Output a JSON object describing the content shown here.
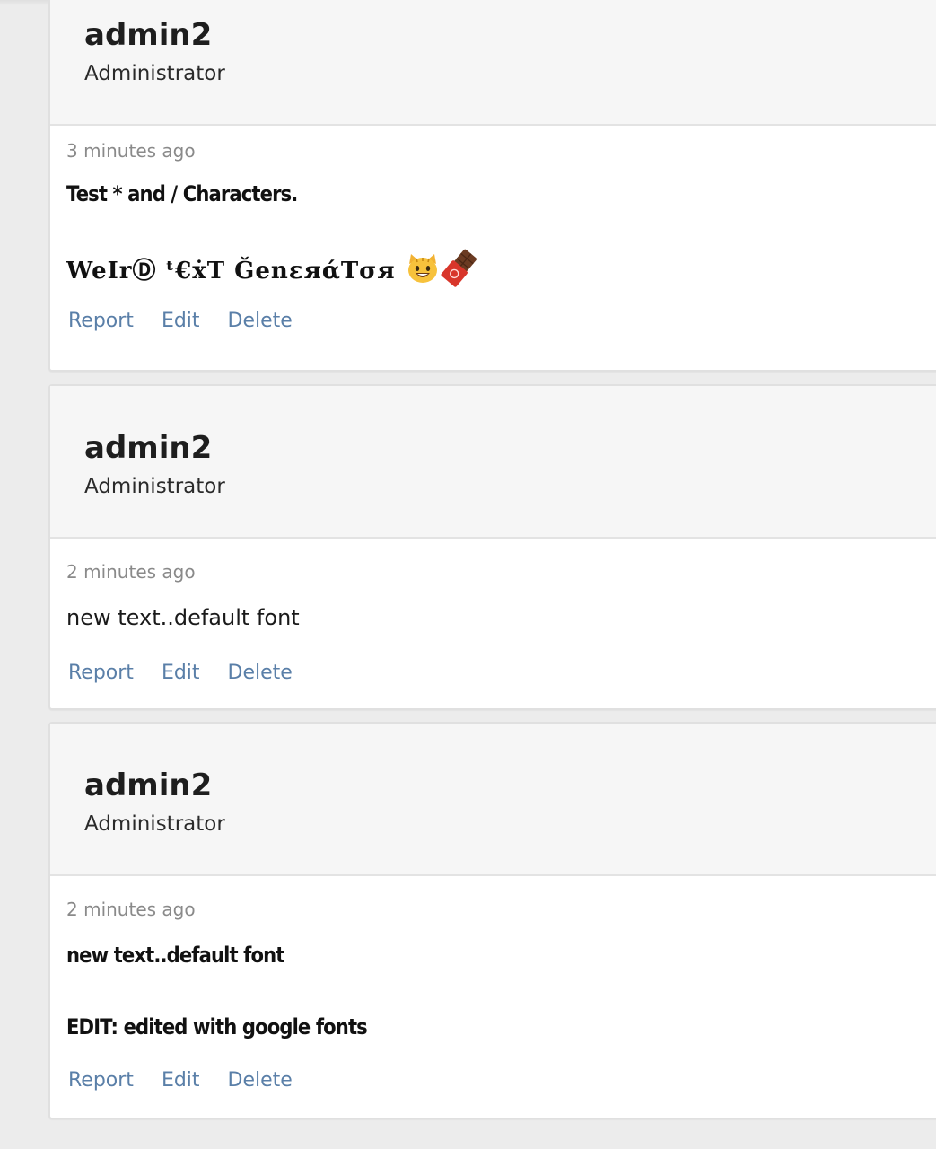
{
  "posts": [
    {
      "author": "admin2",
      "role": "Administrator",
      "time": "3 minutes ago",
      "lines": [
        "Test * and / Characters.",
        "WeIrⒹ ᵗ€ẋT ǦenεяάTσя"
      ],
      "actions": {
        "report": "Report",
        "edit": "Edit",
        "delete": "Delete"
      }
    },
    {
      "author": "admin2",
      "role": "Administrator",
      "time": "2 minutes ago",
      "lines": [
        "new text..default font"
      ],
      "actions": {
        "report": "Report",
        "edit": "Edit",
        "delete": "Delete"
      }
    },
    {
      "author": "admin2",
      "role": "Administrator",
      "time": "2 minutes ago",
      "lines": [
        "new text..default font",
        "EDIT: edited with google fonts"
      ],
      "actions": {
        "report": "Report",
        "edit": "Edit",
        "delete": "Delete"
      }
    }
  ],
  "icons": {
    "cat": "grinning-cat-emoji-icon",
    "chocolate": "chocolate-bar-emoji-icon"
  },
  "colors": {
    "link": "#5a7fa8",
    "header_bg": "#f6f6f6",
    "timestamp": "#8a8a8a"
  }
}
